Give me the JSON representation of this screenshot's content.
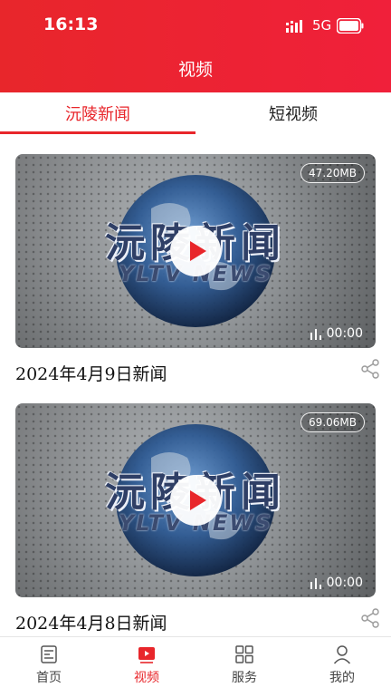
{
  "status": {
    "time": "16:13",
    "network": "5G"
  },
  "header": {
    "title": "视频"
  },
  "tabs": [
    {
      "label": "沅陵新闻",
      "active": true
    },
    {
      "label": "短视频",
      "active": false
    }
  ],
  "videos": [
    {
      "thumb_title": "沅陵新闻",
      "thumb_subtitle": "YLTV NEWS",
      "size": "47.20MB",
      "duration": "00:00",
      "title": "2024年4月9日新闻"
    },
    {
      "thumb_title": "沅陵新闻",
      "thumb_subtitle": "YLTV NEWS",
      "size": "69.06MB",
      "duration": "00:00",
      "title": "2024年4月8日新闻"
    }
  ],
  "bottom_nav": [
    {
      "label": "首页",
      "icon": "news-icon",
      "active": false
    },
    {
      "label": "视频",
      "icon": "video-icon",
      "active": true
    },
    {
      "label": "服务",
      "icon": "grid-icon",
      "active": false
    },
    {
      "label": "我的",
      "icon": "user-icon",
      "active": false
    }
  ],
  "colors": {
    "accent": "#e8262b",
    "header_start": "#e8262b",
    "header_end": "#f0203a"
  }
}
